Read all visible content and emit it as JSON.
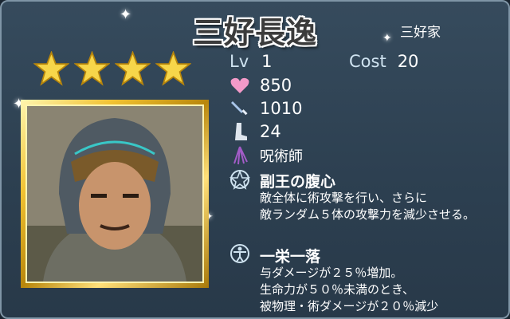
{
  "card": {
    "name": "三好長逸",
    "clan": "三好家",
    "rarity_stars": 4,
    "level_label": "Lv",
    "level": "1",
    "cost_label": "Cost",
    "cost": "20",
    "hp": "850",
    "attack": "1010",
    "speed": "24",
    "class": "呪術師",
    "skill": {
      "name": "副王の腹心",
      "lines": [
        "敵全体に術攻撃を行い、さらに",
        "敵ランダム５体の攻撃力を減少させる。"
      ]
    },
    "passive": {
      "name": "一栄一落",
      "lines": [
        "与ダメージが２５％増加。",
        "生命力が５０％未満のとき、",
        "被物理・術ダメージが２０％減少"
      ]
    }
  },
  "icons": {
    "hp": "heart-icon",
    "attack": "sword-icon",
    "speed": "boot-icon",
    "class": "whip-icon",
    "skill": "pentagram-icon",
    "passive": "figure-icon"
  },
  "colors": {
    "background": "#2d4051",
    "star": "#f7d64a",
    "frame_gold": "#e2b22c",
    "heart": "#f39ac8",
    "sword": "#a9c6ea",
    "boot": "#dfe6ee",
    "whip": "#a35cc8"
  }
}
